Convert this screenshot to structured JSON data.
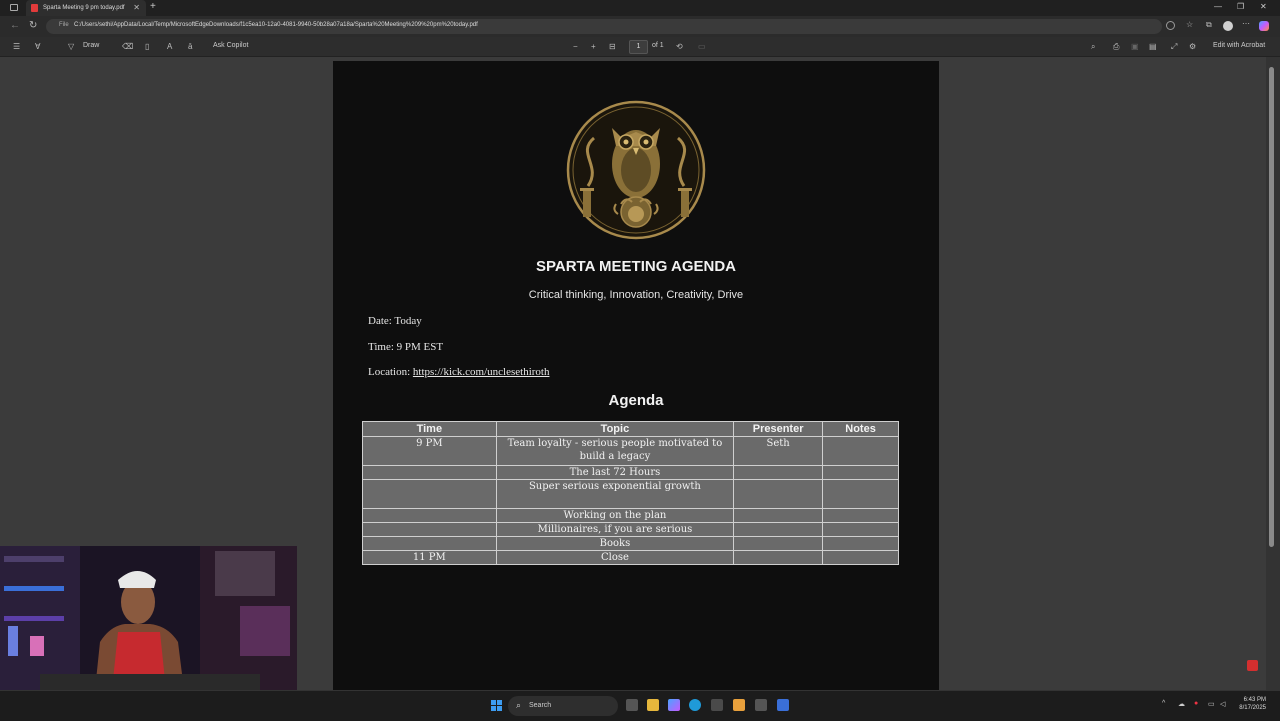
{
  "browser": {
    "tab_title": "Sparta Meeting 9 pm today.pdf",
    "url_scheme": "File",
    "url": "C:/Users/sethi/AppData/Local/Temp/MicrosoftEdgeDownloads/f1c5ea10-12a0-4081-9940-50b28a07a18a/Sparta%20Meeting%209%20pm%20today.pdf"
  },
  "pdf_toolbar": {
    "draw_label": "Draw",
    "ask_copilot_label": "Ask Copilot",
    "page_current": "1",
    "page_total": "of 1",
    "edit_acrobat_label": "Edit with Acrobat"
  },
  "document": {
    "title": "SPARTA MEETING AGENDA",
    "subtitle": "Critical thinking, Innovation, Creativity, Drive",
    "date_line": "Date: Today",
    "time_line": "Time: 9 PM EST",
    "location_label": "Location: ",
    "location_link": "https://kick.com/unclesethiroth",
    "agenda_heading": "Agenda",
    "table": {
      "headers": [
        "Time",
        "Topic",
        "Presenter",
        "Notes"
      ],
      "rows": [
        [
          "9 PM",
          "Team loyalty - serious people motivated to build a legacy",
          "Seth",
          ""
        ],
        [
          "",
          "The last 72 Hours",
          "",
          ""
        ],
        [
          "",
          "Super serious exponential growth",
          "",
          ""
        ],
        [
          "",
          "Working on the plan",
          "",
          ""
        ],
        [
          "",
          "Millionaires, if you are serious",
          "",
          ""
        ],
        [
          "",
          "Books",
          "",
          ""
        ],
        [
          "11 PM",
          "Close",
          "",
          ""
        ]
      ]
    }
  },
  "taskbar": {
    "search_placeholder": "Search",
    "time": "6:43 PM",
    "date": "8/17/2025"
  },
  "colors": {
    "page_bg": "#0e0e0e",
    "table_bg": "#6a6a6a",
    "logo_gold": "#a88a4c",
    "viewer_bg": "#3b3b3b"
  }
}
